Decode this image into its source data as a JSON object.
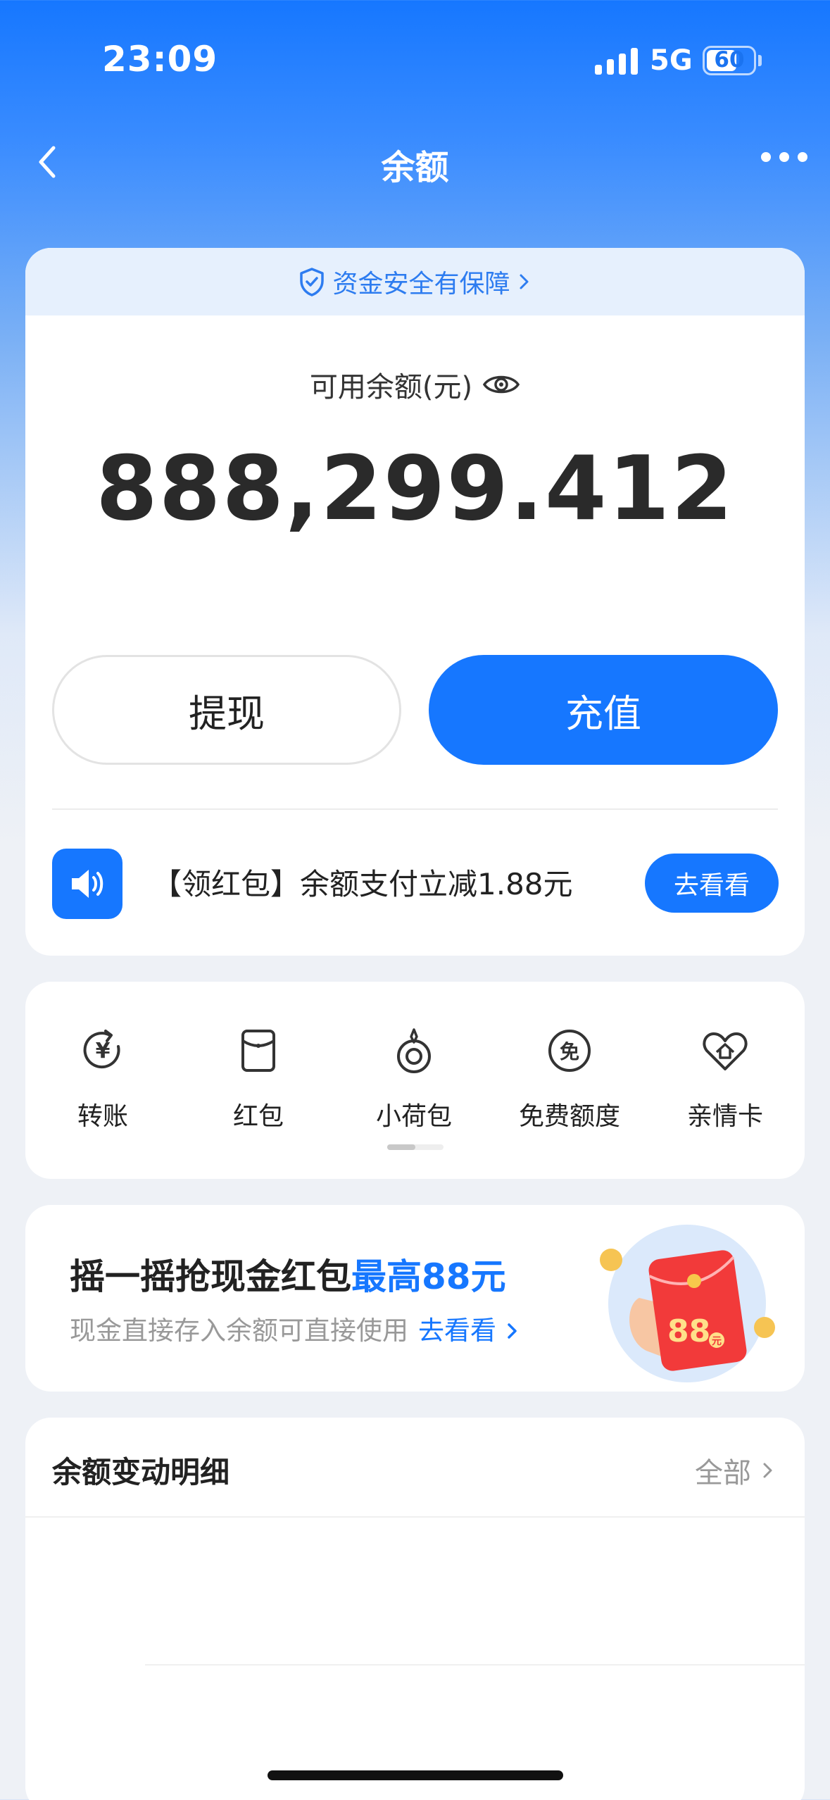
{
  "status_bar": {
    "time": "23:09",
    "network": "5G",
    "battery": "60"
  },
  "nav": {
    "title": "余额"
  },
  "balance": {
    "safety_text": "资金安全有保障",
    "label": "可用余额(元)",
    "amount": "888,299.412",
    "withdraw_label": "提现",
    "recharge_label": "充值",
    "promo_text": "【领红包】余额支付立减1.88元",
    "promo_button": "去看看"
  },
  "quick_actions": [
    {
      "label": "转账",
      "icon": "transfer-icon"
    },
    {
      "label": "红包",
      "icon": "red-packet-icon"
    },
    {
      "label": "小荷包",
      "icon": "pouch-icon"
    },
    {
      "label": "免费额度",
      "icon": "free-quota-icon"
    },
    {
      "label": "亲情卡",
      "icon": "family-card-icon"
    }
  ],
  "shake_promo": {
    "title": "摇一摇抢现金红包",
    "highlight": "最高88元",
    "subtitle": "现金直接存入余额可直接使用",
    "link": "去看看",
    "badge_number": "88",
    "badge_unit": "元"
  },
  "details": {
    "title": "余额变动明细",
    "all_label": "全部"
  },
  "colors": {
    "accent": "#1677ff",
    "safety_bg": "#e6f0fd"
  }
}
